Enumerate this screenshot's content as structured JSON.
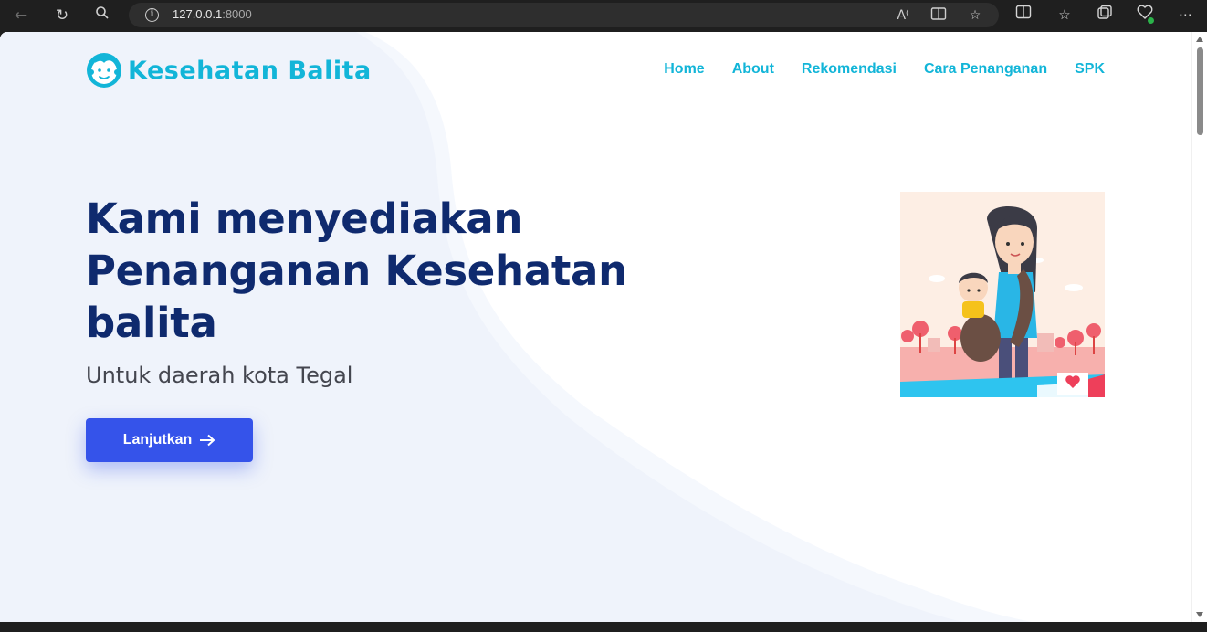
{
  "browser": {
    "url_host": "127.0.0.1",
    "url_port": ":8000"
  },
  "brand": {
    "name": "Kesehatan Balita"
  },
  "nav": {
    "items": [
      {
        "label": "Home"
      },
      {
        "label": "About"
      },
      {
        "label": "Rekomendasi"
      },
      {
        "label": "Cara Penanganan"
      },
      {
        "label": "SPK"
      }
    ]
  },
  "hero": {
    "title": "Kami menyediakan Penanganan Kesehatan balita",
    "subtitle": "Untuk daerah kota Tegal",
    "cta_label": "Lanjutkan",
    "image_alt": "mother carrying baby illustration"
  },
  "colors": {
    "brand": "#12b5d8",
    "title": "#0f2a6e",
    "button": "#3553ea",
    "background_shape": "#eef3fb"
  }
}
